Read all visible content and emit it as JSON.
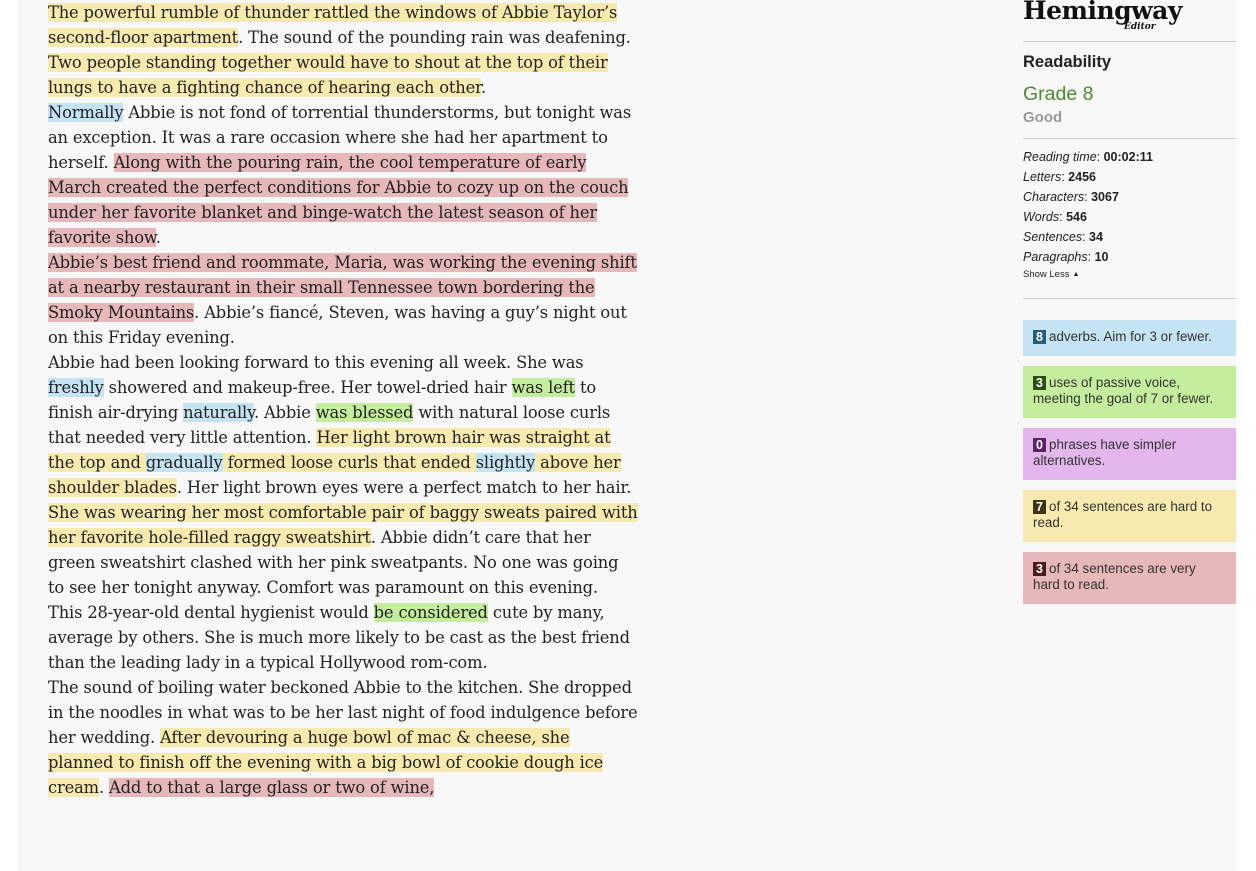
{
  "app": {
    "logo_name": "Hemingway",
    "logo_sub": "Editor"
  },
  "paragraphs": [
    [
      {
        "t": "The powerful rumble of thunder rattled the windows of Abbie Taylor’s second-floor apartment",
        "h": "y"
      },
      {
        "t": ". The sound of the pounding rain was deafening. ",
        "h": ""
      },
      {
        "t": "Two people standing together would have to shout at the top of their lungs to have a fighting chance of hearing each other",
        "h": "y"
      },
      {
        "t": ".",
        "h": ""
      }
    ],
    [
      {
        "t": "Normally",
        "h": "b"
      },
      {
        "t": " Abbie is not fond of torrential thunderstorms, but tonight was an exception. It was a rare occasion where she had her apartment to herself. ",
        "h": ""
      },
      {
        "t": "Along with the pouring rain, the cool temperature of early March created the perfect conditions for Abbie to cozy up on the couch under her favorite blanket and binge-watch the latest season of her favorite show",
        "h": "r"
      },
      {
        "t": ".",
        "h": ""
      }
    ],
    [
      {
        "t": "Abbie’s best friend and roommate, Maria, was working the evening shift at a nearby restaurant in their small Tennessee town bordering the Smoky Mountains",
        "h": "r"
      },
      {
        "t": ". Abbie’s fiancé, Steven, was having a guy’s night out on this Friday evening.",
        "h": ""
      }
    ],
    [
      {
        "t": "Abbie had been looking forward to this evening all week. She was ",
        "h": ""
      },
      {
        "t": "freshly",
        "h": "b"
      },
      {
        "t": " showered and makeup-free. Her towel-dried hair ",
        "h": ""
      },
      {
        "t": "was left",
        "h": "g"
      },
      {
        "t": " to finish air-drying ",
        "h": ""
      },
      {
        "t": "naturally",
        "h": "b"
      },
      {
        "t": ". Abbie ",
        "h": ""
      },
      {
        "t": "was blessed",
        "h": "g"
      },
      {
        "t": " with natural loose curls that needed very little attention. ",
        "h": ""
      },
      {
        "t": "Her light brown hair was straight at the top and ",
        "h": "y"
      },
      {
        "t": "gradually",
        "h": "b"
      },
      {
        "t": " formed loose curls that ended ",
        "h": "y"
      },
      {
        "t": "slightly",
        "h": "b"
      },
      {
        "t": " above her shoulder blades",
        "h": "y"
      },
      {
        "t": ". Her light brown eyes were a perfect match to her hair.",
        "h": ""
      }
    ],
    [
      {
        "t": "She was wearing her most comfortable pair of baggy sweats paired with her favorite hole-filled raggy sweatshirt",
        "h": "y"
      },
      {
        "t": ".  Abbie didn’t care that her green sweatshirt clashed with her pink sweatpants. No one was going to see her tonight anyway. Comfort was paramount on this evening.",
        "h": ""
      }
    ],
    [
      {
        "t": "This 28-year-old dental hygienist would ",
        "h": ""
      },
      {
        "t": "be considered",
        "h": "g"
      },
      {
        "t": " cute by many, average by others. She is much more likely to be cast as the best friend than the leading lady in a typical Hollywood rom-com.",
        "h": ""
      }
    ],
    [
      {
        "t": "The sound of boiling water beckoned Abbie to the kitchen. She dropped in the noodles in what was to be her last night of food indulgence before her wedding. ",
        "h": ""
      },
      {
        "t": "After devouring a huge bowl of mac & cheese, she planned to finish off the evening with a big bowl of cookie dough ice cream",
        "h": "y"
      },
      {
        "t": ". ",
        "h": ""
      },
      {
        "t": "Add to that a large glass or two of wine,",
        "h": "r"
      }
    ]
  ],
  "sidebar": {
    "readability_heading": "Readability",
    "grade": "Grade 8",
    "grade_rating": "Good",
    "stats": [
      {
        "label": "Reading time",
        "value": "00:02:11"
      },
      {
        "label": "Letters",
        "value": "2456"
      },
      {
        "label": "Characters",
        "value": "3067"
      },
      {
        "label": "Words",
        "value": "546"
      },
      {
        "label": "Sentences",
        "value": "34"
      },
      {
        "label": "Paragraphs",
        "value": "10"
      }
    ],
    "show_less": "Show Less",
    "cards": [
      {
        "count": "8",
        "text": "adverbs. Aim for 3 or fewer.",
        "bg": "#c4e3f3",
        "badge": "#255b7d"
      },
      {
        "count": "3",
        "text": "uses of passive voice, meeting the goal of 7 or fewer.",
        "bg": "#c4ed9d",
        "badge": "#2d4f12"
      },
      {
        "count": "0",
        "text": "phrases have simpler alternatives.",
        "bg": "#e3b7eb",
        "badge": "#5b2563"
      },
      {
        "count": "7",
        "text": "of 34 sentences are hard to read.",
        "bg": "#f7eaaf",
        "badge": "#3e3512"
      },
      {
        "count": "3",
        "text": "of 34 sentences are very hard to read.",
        "bg": "#e7b8b9",
        "badge": "#4b1c1d"
      }
    ]
  }
}
